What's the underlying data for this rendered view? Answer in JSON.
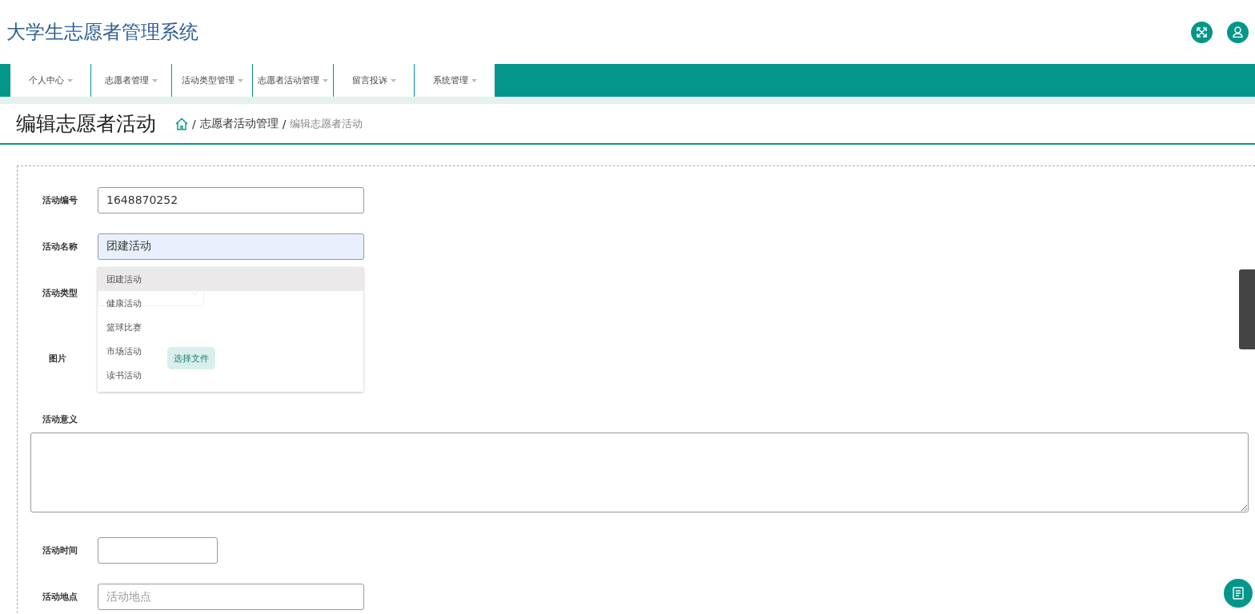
{
  "header": {
    "title": "大学生志愿者管理系统"
  },
  "nav": [
    {
      "label": "个人中心"
    },
    {
      "label": "志愿者管理"
    },
    {
      "label": "活动类型管理"
    },
    {
      "label": "志愿者活动管理"
    },
    {
      "label": "留言投诉"
    },
    {
      "label": "系统管理"
    }
  ],
  "page_title": "编辑志愿者活动",
  "breadcrumb_separator": "/",
  "breadcrumb": [
    {
      "label": "志愿者活动管理",
      "current": false
    },
    {
      "label": "编辑志愿者活动",
      "current": true
    }
  ],
  "form": {
    "fields": [
      {
        "kind": "text",
        "label": "活动编号",
        "value": "1648870252",
        "focused": false
      },
      {
        "kind": "text",
        "label": "活动名称",
        "value": "团建活动",
        "focused": true
      },
      {
        "kind": "select",
        "label": "活动类型"
      },
      {
        "kind": "file",
        "label": "图片",
        "button": "选择文件"
      },
      {
        "kind": "textarea",
        "label": "活动意义"
      },
      {
        "kind": "date",
        "label": "活动时间"
      },
      {
        "kind": "text",
        "label": "活动地点",
        "placeholder": "活动地点",
        "focused": false
      }
    ]
  },
  "autocomplete": {
    "items": [
      {
        "label": "团建活动",
        "selected": true
      },
      {
        "label": "健康活动",
        "selected": false
      },
      {
        "label": "篮球比赛",
        "selected": false
      },
      {
        "label": "市场活动",
        "selected": false
      },
      {
        "label": "读书活动",
        "selected": false
      }
    ]
  }
}
